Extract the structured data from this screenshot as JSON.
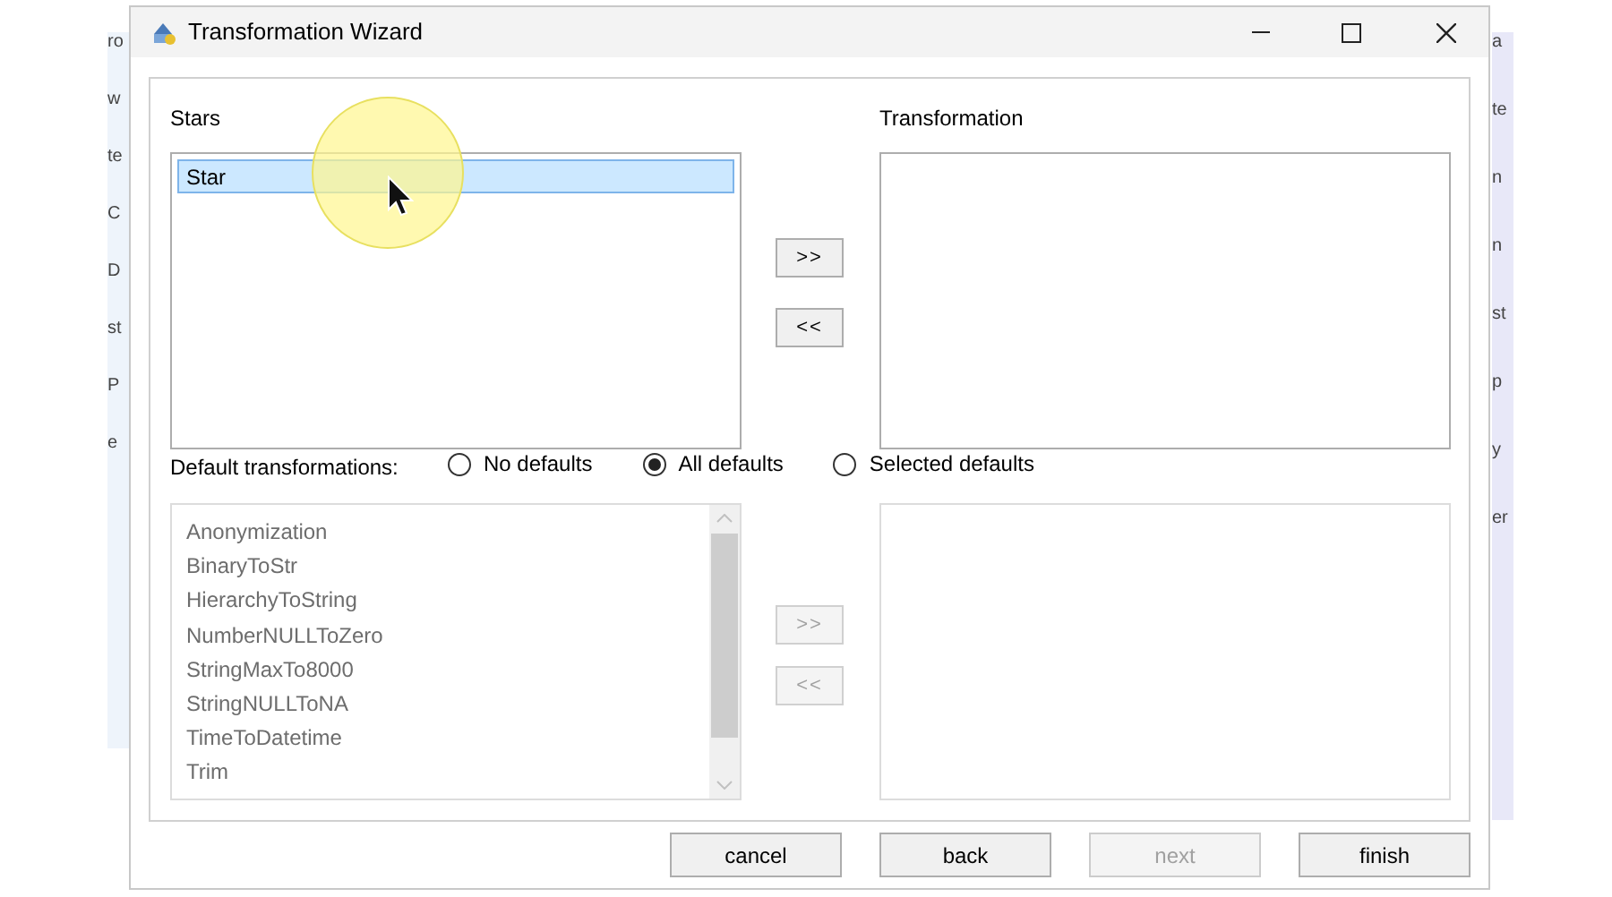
{
  "background_left": [
    "ro",
    "w",
    "te",
    "C",
    "D",
    "st",
    "P",
    "e"
  ],
  "background_right": [
    "a",
    "te",
    "n",
    "n",
    "st",
    "p",
    "y",
    "er"
  ],
  "window": {
    "title": "Transformation Wizard"
  },
  "stars": {
    "label": "Stars",
    "items": [
      {
        "text": "Star",
        "selected": true
      }
    ]
  },
  "transformation": {
    "label": "Transformation"
  },
  "upper_buttons": [
    {
      "text": ">>",
      "disabled": false
    },
    {
      "text": "<<",
      "disabled": false
    }
  ],
  "defaults": {
    "label": "Default transformations:",
    "options": [
      {
        "text": "No defaults",
        "selected": false
      },
      {
        "text": "All defaults",
        "selected": true
      },
      {
        "text": "Selected defaults",
        "selected": false
      }
    ]
  },
  "default_list": {
    "disabled": true,
    "items": [
      "Anonymization",
      "BinaryToStr",
      "HierarchyToString",
      "NumberNULLToZero",
      "StringMaxTo8000",
      "StringNULLToNA",
      "TimeToDatetime",
      "Trim"
    ]
  },
  "lower_buttons": [
    {
      "text": ">>",
      "disabled": true
    },
    {
      "text": "<<",
      "disabled": true
    }
  ],
  "footer_buttons": [
    {
      "text": "cancel",
      "disabled": false
    },
    {
      "text": "back",
      "disabled": false
    },
    {
      "text": "next",
      "disabled": true
    },
    {
      "text": "finish",
      "disabled": false
    }
  ]
}
